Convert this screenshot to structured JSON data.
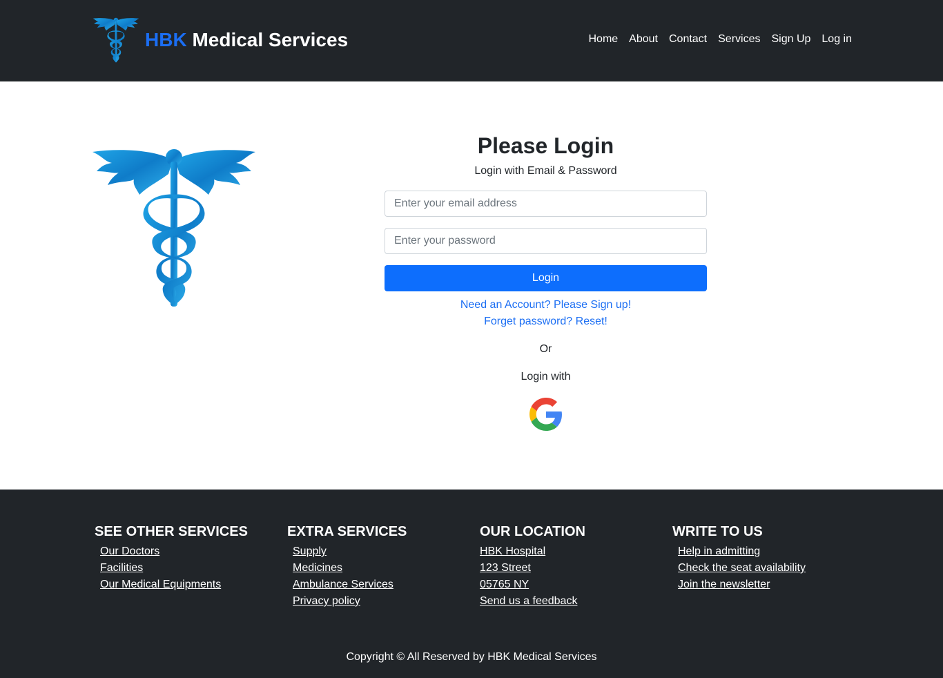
{
  "colors": {
    "header_bg": "#212529",
    "accent": "#1b6ef3",
    "primary_button": "#0d6efd"
  },
  "brand": {
    "accent_text": "HBK",
    "rest_text": " Medical Services",
    "logo_icon": "caduceus-icon"
  },
  "nav": {
    "items": [
      "Home",
      "About",
      "Contact",
      "Services",
      "Sign Up",
      "Log in"
    ]
  },
  "login": {
    "title": "Please Login",
    "subtitle": "Login with Email & Password",
    "email_placeholder": "Enter your email address",
    "password_placeholder": "Enter your password",
    "button_label": "Login",
    "signup_link": "Need an Account? Please Sign up!",
    "reset_link": "Forget password? Reset!",
    "or_text": "Or",
    "login_with_text": "Login with",
    "social_icon": "google-icon"
  },
  "footer": {
    "columns": [
      {
        "heading": "SEE OTHER SERVICES",
        "links": [
          "Our Doctors",
          "Facilities",
          "Our Medical Equipments"
        ]
      },
      {
        "heading": "EXTRA SERVICES",
        "links": [
          "Supply",
          "Medicines",
          "Ambulance Services",
          "Privacy policy"
        ]
      },
      {
        "heading": "OUR LOCATION",
        "links": [
          "HBK Hospital",
          "123 Street",
          "05765 NY",
          "Send us a feedback"
        ]
      },
      {
        "heading": "WRITE TO US",
        "links": [
          "Help in admitting",
          "Check the seat availability",
          "Join the newsletter"
        ]
      }
    ],
    "copyright": "Copyright © All Reserved by HBK Medical Services"
  }
}
